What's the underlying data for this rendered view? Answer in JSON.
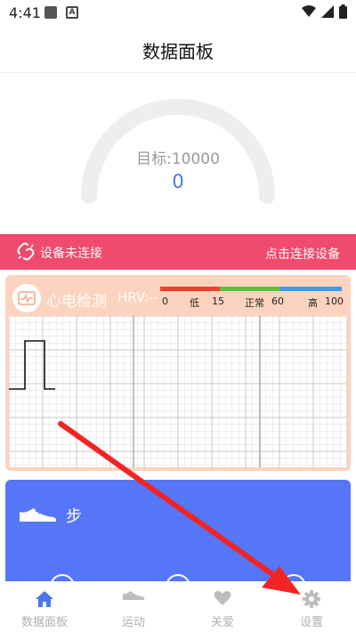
{
  "status": {
    "time": "4:41",
    "notif_icon_a": "A"
  },
  "header": {
    "title": "数据面板"
  },
  "gauge": {
    "target_label": "目标:10000",
    "value": "0",
    "progress": 0
  },
  "device": {
    "status": "设备未连接",
    "connect_action": "点击连接设备"
  },
  "ecg": {
    "title": "心电检测",
    "hrv_label": "HRV:--",
    "scale_ticks": [
      "0",
      "低",
      "15",
      "正常",
      "60",
      "高",
      "100"
    ],
    "scale_colors": [
      "#f0402e",
      "#55c23a",
      "#3c9ef0"
    ]
  },
  "steps": {
    "label": "步"
  },
  "nav": {
    "items": [
      {
        "label": "数据面板",
        "icon": "home-icon",
        "active": true
      },
      {
        "label": "运动",
        "icon": "sneaker-icon",
        "active": false
      },
      {
        "label": "关爱",
        "icon": "heart-icon",
        "active": false
      },
      {
        "label": "设置",
        "icon": "gear-icon",
        "active": false
      }
    ]
  },
  "colors": {
    "accent": "#4a78e8",
    "connection_bar": "#f04a6c",
    "ecg_card": "#fcd3be",
    "steps_card": "#5576f7",
    "annotation_arrow": "#f22424"
  }
}
